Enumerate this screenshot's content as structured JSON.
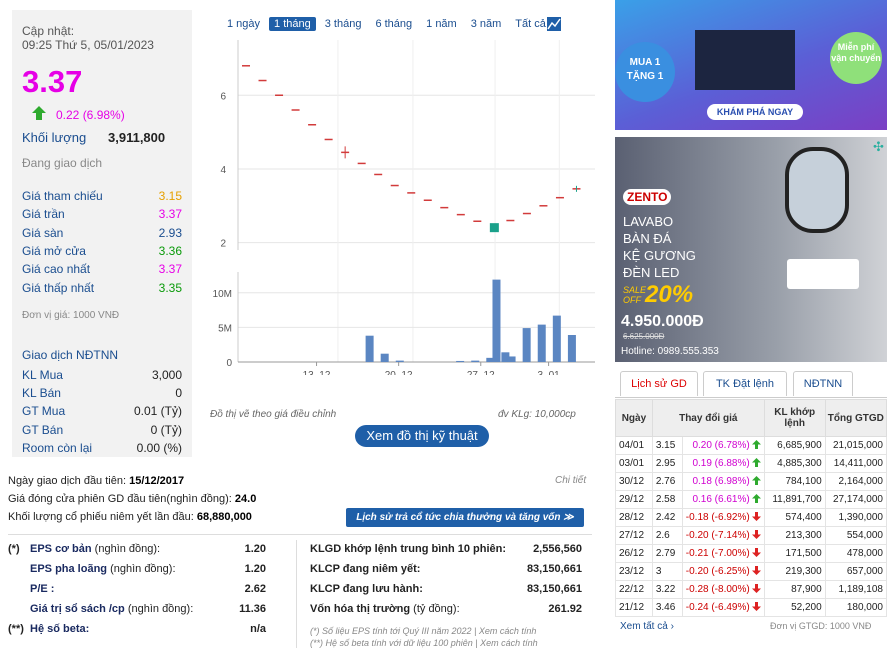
{
  "stock": {
    "update_label": "Cập nhật:",
    "update_time": "09:25 Thứ 5, 05/01/2023",
    "price": "3.37",
    "change": "0.22 (6.98%)",
    "volume_label": "Khối lượng",
    "volume": "3,911,800",
    "status": "Đang giao dịch",
    "prices": [
      {
        "label": "Giá tham chiếu",
        "value": "3.15",
        "color": "#e6a000"
      },
      {
        "label": "Giá trần",
        "value": "3.37",
        "color": "#e600e6"
      },
      {
        "label": "Giá sàn",
        "value": "2.93",
        "color": "#1a4d8f"
      },
      {
        "label": "Giá mở cửa",
        "value": "3.36",
        "color": "#0a9a0a"
      },
      {
        "label": "Giá cao nhất",
        "value": "3.37",
        "color": "#e600e6"
      },
      {
        "label": "Giá thấp nhất",
        "value": "3.35",
        "color": "#0a9a0a"
      }
    ],
    "unit": "Đơn vị giá: 1000 VNĐ",
    "foreign_title": "Giao dịch NĐTNN",
    "foreign": [
      {
        "label": "KL Mua",
        "value": "3,000"
      },
      {
        "label": "KL Bán",
        "value": "0"
      },
      {
        "label": "GT Mua",
        "value": "0.01 (Tỷ)"
      },
      {
        "label": "GT Bán",
        "value": "0 (Tỷ)"
      },
      {
        "label": "Room còn lại",
        "value": "0.00 (%)"
      }
    ]
  },
  "range_tabs": [
    "1 ngày",
    "1 tháng",
    "3 tháng",
    "6 tháng",
    "1 năm",
    "3 năm",
    "Tất cả"
  ],
  "chart_data": {
    "type": "line",
    "price_series": [
      6.8,
      6.4,
      6.0,
      5.6,
      5.2,
      4.8,
      4.45,
      4.15,
      3.85,
      3.55,
      3.35,
      3.15,
      2.95,
      2.76,
      2.58,
      2.42,
      2.6,
      2.79,
      3.0,
      3.22,
      3.46
    ],
    "price_yticks": [
      "6",
      "4",
      "2"
    ],
    "price_ylim": [
      1.8,
      7.5
    ],
    "volume_series": [
      0,
      0,
      0,
      0,
      0,
      0,
      0,
      3.8,
      1.2,
      0.2,
      0,
      0,
      0,
      0.15,
      0.2,
      0.6,
      1.4,
      11.9,
      0.8,
      4.9,
      5.4,
      6.7,
      3.9
    ],
    "volume_yticks": [
      "10M",
      "5M",
      "0"
    ],
    "volume_ylim": [
      0,
      13
    ],
    "x_ticks": [
      "13. 12",
      "20. 12",
      "27. 12",
      "3. 01"
    ],
    "note_left": "Đồ thị vẽ theo giá điều chỉnh",
    "note_right": "đv KLg: 10,000cp"
  },
  "tech_button": "Xem đồ thị kỹ thuật",
  "listing": {
    "first_day_label": "Ngày giao dịch đầu tiên:",
    "first_day": "15/12/2017",
    "detail": "Chi tiết",
    "first_close_label": "Giá đóng cửa phiên GD đầu tiên(nghìn đồng):",
    "first_close": "24.0",
    "shares_label": "Khối lượng cổ phiếu niêm yết lần đầu:",
    "shares": "68,880,000",
    "history_btn": "Lịch sử trả cổ tức chia thưởng và tăng vốn ≫"
  },
  "fundamentals_left": [
    {
      "label": "EPS cơ bản",
      "unit": " (nghìn đồng):",
      "value": "1.20",
      "prefix": "(*)"
    },
    {
      "label": "EPS pha loãng",
      "unit": " (nghìn đồng):",
      "value": "1.20",
      "prefix": ""
    },
    {
      "label": "P/E :",
      "unit": "",
      "value": "2.62",
      "prefix": ""
    },
    {
      "label": "Giá trị sổ sách /cp",
      "unit": " (nghìn đồng):",
      "value": "11.36",
      "prefix": ""
    },
    {
      "label": "Hệ số beta:",
      "unit": "",
      "value": "n/a",
      "prefix": "(**)"
    }
  ],
  "fundamentals_right": [
    {
      "label": "KLGD khớp lệnh trung bình 10 phiên:",
      "value": "2,556,560"
    },
    {
      "label": "KLCP đang niêm yết:",
      "value": "83,150,661"
    },
    {
      "label": "KLCP đang lưu hành:",
      "value": "83,150,661"
    },
    {
      "label": "Vốn hóa thị trường",
      "unit": " (tỷ đồng):",
      "value": "261.92"
    }
  ],
  "footnotes": [
    "(*) Số liệu EPS tính tới Quý III năm 2022 | Xem cách tính",
    "(**) Hệ số beta tính với dữ liệu 100 phiên | Xem cách tính"
  ],
  "ad2": {
    "brand": "ZENTO",
    "lines": [
      "LAVABO",
      "BÀN ĐÁ",
      "KỆ GƯƠNG",
      "ĐÈN LED"
    ],
    "sale": "SALE OFF",
    "pct": "20%",
    "price": "4.950.000Đ",
    "old_price": "6.625.000Đ",
    "hotline": "Hotline: 0989.555.353"
  },
  "ad1": {
    "text": "MUA 1 TẶNG 1",
    "cta": "KHÁM PHÁ NGAY",
    "free": "Miễn phí vận chuyển"
  },
  "trade_tabs": [
    "Lịch sử GD",
    "TK Đặt lệnh",
    "NĐTNN"
  ],
  "trade_table": {
    "headers": [
      "Ngày",
      "Thay đổi giá",
      "KL khớp lệnh",
      "Tổng GTGD"
    ],
    "rows": [
      {
        "date": "04/01",
        "price": "3.15",
        "chg": "0.20 (6.78%)",
        "dir": "up",
        "vol": "6,685,900",
        "val": "21,015,000"
      },
      {
        "date": "03/01",
        "price": "2.95",
        "chg": "0.19 (6.88%)",
        "dir": "up",
        "vol": "4,885,300",
        "val": "14,411,000"
      },
      {
        "date": "30/12",
        "price": "2.76",
        "chg": "0.18 (6.98%)",
        "dir": "up",
        "vol": "784,100",
        "val": "2,164,000"
      },
      {
        "date": "29/12",
        "price": "2.58",
        "chg": "0.16 (6.61%)",
        "dir": "up",
        "vol": "11,891,700",
        "val": "27,174,000"
      },
      {
        "date": "28/12",
        "price": "2.42",
        "chg": "-0.18 (-6.92%)",
        "dir": "dn",
        "vol": "574,400",
        "val": "1,390,000"
      },
      {
        "date": "27/12",
        "price": "2.6",
        "chg": "-0.20 (-7.14%)",
        "dir": "dn",
        "vol": "213,300",
        "val": "554,000"
      },
      {
        "date": "26/12",
        "price": "2.79",
        "chg": "-0.21 (-7.00%)",
        "dir": "dn",
        "vol": "171,500",
        "val": "478,000"
      },
      {
        "date": "23/12",
        "price": "3",
        "chg": "-0.20 (-6.25%)",
        "dir": "dn",
        "vol": "219,300",
        "val": "657,000"
      },
      {
        "date": "22/12",
        "price": "3.22",
        "chg": "-0.28 (-8.00%)",
        "dir": "dn",
        "vol": "87,900",
        "val": "1,189,108"
      },
      {
        "date": "21/12",
        "price": "3.46",
        "chg": "-0.24 (-6.49%)",
        "dir": "dn",
        "vol": "52,200",
        "val": "180,000"
      }
    ],
    "see_all": "Xem tất cả ›",
    "unit": "Đơn vị GTGD: 1000 VNĐ"
  },
  "colors": {
    "accent": "#1f5fa8",
    "up": "#e600e6",
    "down": "#cc0000",
    "green": "#0a9a0a"
  }
}
